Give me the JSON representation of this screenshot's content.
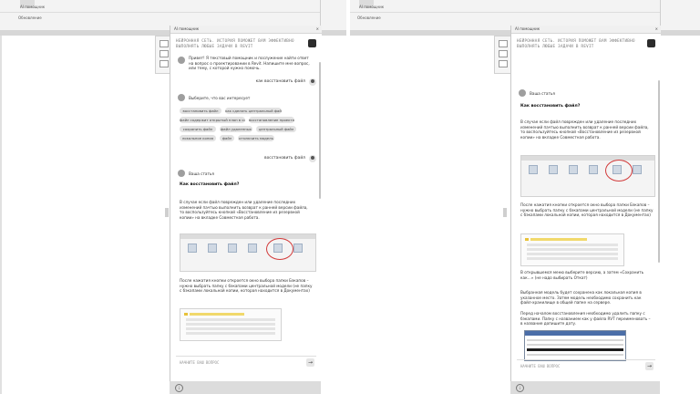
{
  "top": {
    "help_label": "AI помощник",
    "help_icon": "person-icon",
    "tab_label": "Обновление"
  },
  "assistant": {
    "title": "AI помощник",
    "banner": "НЕЙРОННАЯ СЕТЬ. ИСТОРИЯ ПОМОЖЕТ ВАМ ЭФФЕКТИВНО ВЫПОЛНЯТЬ ЛЮБЫЕ ЗАДАЧИ В REVIT",
    "greeting": "Привет! Я текстовый помощник и послужение найти ответ на вопрос о проектировании в Revit. Напишите мне вопрос, или тему, с которой нужно помочь.",
    "user_query_1": "как восстановить файл",
    "choose_prompt": "Выберите, что вас интересует",
    "chips": [
      "восстановить файл",
      "как сделать центральный файл",
      "файл содержит открытый план в синхр",
      "восстановление проекта",
      "сохранить файл",
      "файл удаленных",
      "центральный файл",
      "локальное копия",
      "файл",
      "отключить модель"
    ],
    "user_query_2": "восстановить файл",
    "answer_label": "Ваша статья",
    "article_title": "Как восстановить файл?",
    "para1": "В случае если файл поврежден или удаление последних изменений пачтью выполнить возврат к ранней версии файла, то воспользуйтесь кнопкой «Восстановление из резервной копии» на вкладке Совместная работа.",
    "para2": "После нажатия кнопки откроется окно выбора папки Бэкапов – нужно выбрать папку с бэкапами центральной модели (не папку с бэкапами локальной копии, которая находится в Документах)",
    "para3": "В открывшемся меню выберите версию, а затем «Сохранить как…» (не надо выбирать Откат)",
    "para4": "Выбранная модель будет сохранена как локальная копия в указанное место. Затем модель необходимо сохранить как файл-хранилище в общей папке на сервере.",
    "para5": "Перед началом восстановления необходимо удалить папку с бэкапами. Папку с названием как у файла RVT переименовать – в название допишите дату.",
    "input_placeholder": "НАЧНИТЕ ВАШ ВОПРОС",
    "send_icon": "arrow-right-icon",
    "footer_icon": "info-icon"
  }
}
